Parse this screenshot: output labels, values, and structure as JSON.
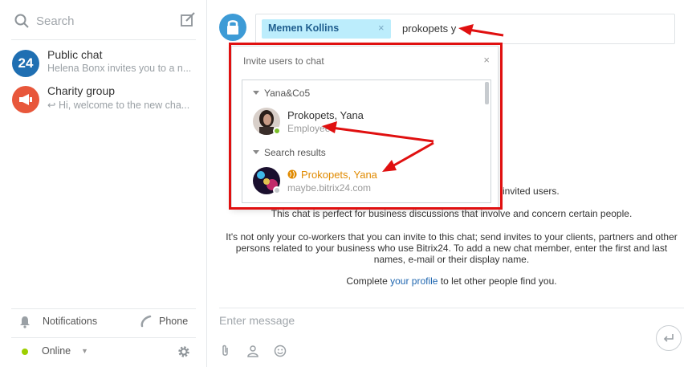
{
  "sidebar": {
    "search_placeholder": "Search",
    "chats": [
      {
        "title": "Public chat",
        "subtitle": "Helena Bonx invites you to a n...",
        "avatar_text": "24",
        "avatar_color": "#1f6fb2"
      },
      {
        "title": "Charity group",
        "subtitle": "Hi, welcome to the new cha...",
        "avatar_color": "#e8573b"
      }
    ],
    "notifications_label": "Notifications",
    "phone_label": "Phone",
    "status_label": "Online",
    "status_color": "#9dcf00"
  },
  "header": {
    "recipient_chip": "Memen Kollins",
    "chip_remove": "×",
    "input_value": "prokopets y"
  },
  "popup": {
    "title": "Invite users to chat",
    "close": "×",
    "groups": [
      {
        "header": "Yana&Co5",
        "users": [
          {
            "name": "Prokopets, Yana",
            "subtitle": "Employee",
            "status_color": "#7bbf2a"
          }
        ]
      },
      {
        "header": "Search results",
        "users": [
          {
            "name": "Prokopets, Yana",
            "subtitle": "maybe.bitrix24.com",
            "status_color": "#c5c9cc",
            "external": true
          }
        ]
      }
    ]
  },
  "info": {
    "line_tail": "invited users.",
    "line2": "This chat is perfect for business discussions that involve and concern certain people.",
    "line3": "It's not only your co-workers that you can invite to this chat; send invites to your clients, partners and other",
    "line4": "persons related to your business who use Bitrix24. To add a new chat member, enter the first and last",
    "line5": "names, e-mail or their display name.",
    "profile_prefix": "Complete ",
    "profile_link": "your profile",
    "profile_suffix": " to let other people find you."
  },
  "composer": {
    "placeholder": "Enter message",
    "icons": [
      "paperclip-icon",
      "person-icon",
      "smiley-icon"
    ]
  },
  "annotation_color": "#e01010"
}
